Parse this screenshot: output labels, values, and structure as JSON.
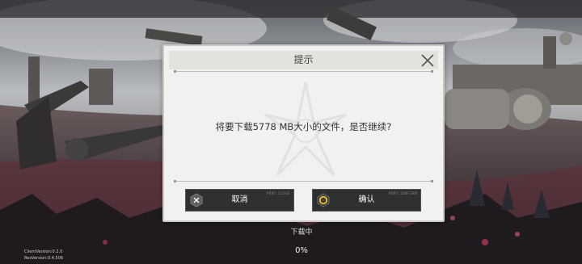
{
  "dialog": {
    "title": "提示",
    "message": "将要下载5778 MB大小的文件，是否继续?",
    "cancel_label": "取消",
    "confirm_label": "确认",
    "cancel_tag": "PORT:CLOSE",
    "confirm_tag": "PORT:CONFIRM"
  },
  "loading": {
    "status_label": "下载中",
    "progress_text": "0%",
    "progress": 0
  },
  "version": {
    "client": "ClientVersion:0.2.0",
    "resource": "ResVersion:0.4.506"
  }
}
